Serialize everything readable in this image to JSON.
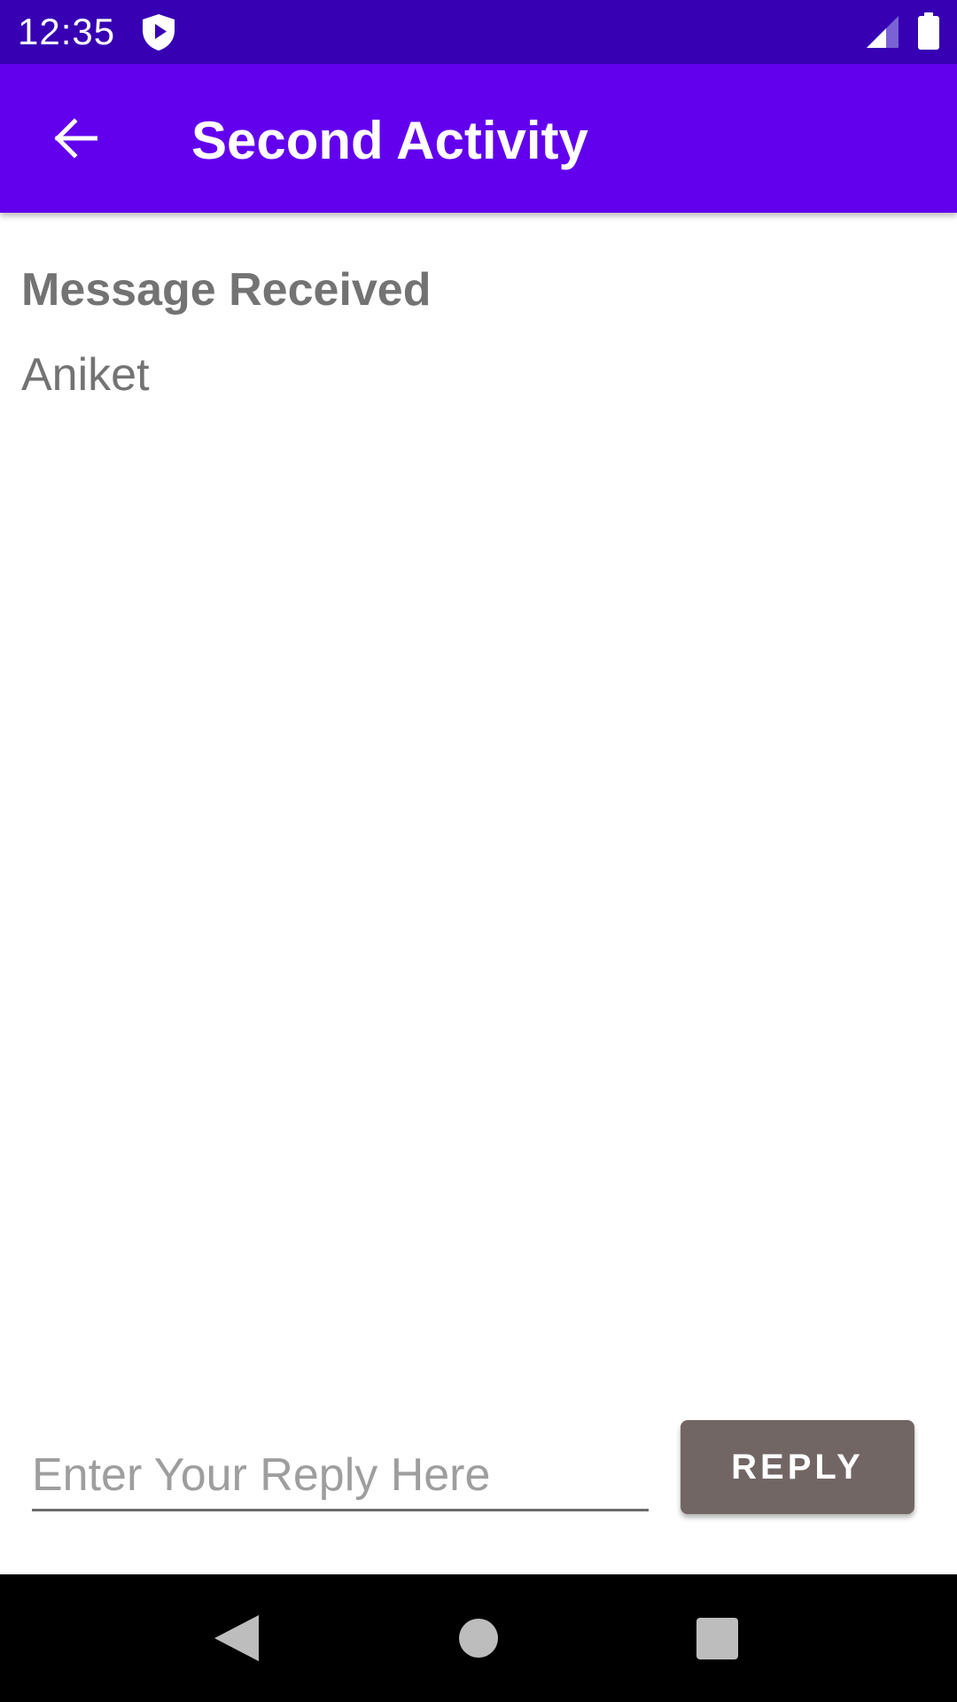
{
  "status_bar": {
    "time": "12:35",
    "icons": [
      "shield-play-icon",
      "signal-icon",
      "battery-icon"
    ],
    "color": "#3700b3"
  },
  "app_bar": {
    "title": "Second Activity",
    "back_icon": "arrow-back-icon",
    "color": "#6200ee"
  },
  "content": {
    "heading": "Message Received",
    "message": "Aniket"
  },
  "reply": {
    "placeholder": "Enter Your Reply Here",
    "value": "",
    "button_label": "REPLY",
    "button_color": "#726664"
  },
  "nav_bar": {
    "icons": [
      "nav-back-icon",
      "nav-home-icon",
      "nav-recents-icon"
    ]
  }
}
